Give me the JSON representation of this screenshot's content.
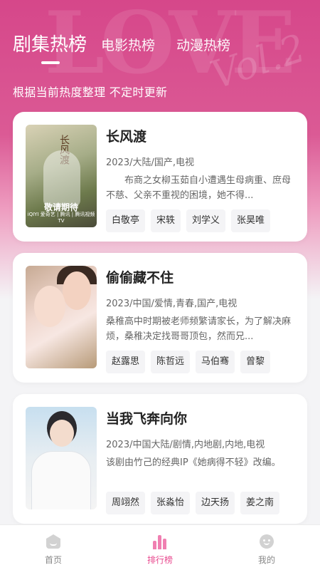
{
  "tabs": {
    "active": "剧集热榜",
    "movie": "电影热榜",
    "anime": "动漫热榜"
  },
  "subtitle": "根据当前热度整理 不定时更新",
  "background_text": {
    "love": "LOVE",
    "vol": "Vol.2"
  },
  "accent_color": "#e8488e",
  "items": [
    {
      "title": "长风渡",
      "meta": "2023/大陆/国产,电视",
      "desc": "布商之女柳玉茹自小遭遇生母病重、庶母不慈、父亲不重视的困境，她不得...",
      "cast": [
        "白敬亭",
        "宋轶",
        "刘学义",
        "张昊唯"
      ],
      "poster": {
        "badge": "敬请期待",
        "brand": "iQIYI 爱奇艺 | 腾讯 | 腾讯视频TV",
        "seal": "长风渡"
      }
    },
    {
      "title": "偷偷藏不住",
      "meta": "2023/中国/爱情,青春,国产,电视",
      "desc": "桑稚高中时期被老师频繁请家长，为了解决麻烦，桑稚决定找哥哥顶包，然而兄...",
      "cast": [
        "赵露思",
        "陈哲远",
        "马伯骞",
        "曾黎"
      ]
    },
    {
      "title": "当我飞奔向你",
      "meta": "2023/中国大陆/剧情,内地剧,内地,电视",
      "desc": "该剧由竹己的经典IP《她病得不轻》改编。",
      "cast": [
        "周翊然",
        "张淼怡",
        "边天扬",
        "姜之南"
      ]
    }
  ],
  "nav": {
    "home": {
      "label": "首页",
      "icon": "home-icon"
    },
    "rank": {
      "label": "排行榜",
      "icon": "ranking-icon"
    },
    "mine": {
      "label": "我的",
      "icon": "user-icon"
    }
  }
}
